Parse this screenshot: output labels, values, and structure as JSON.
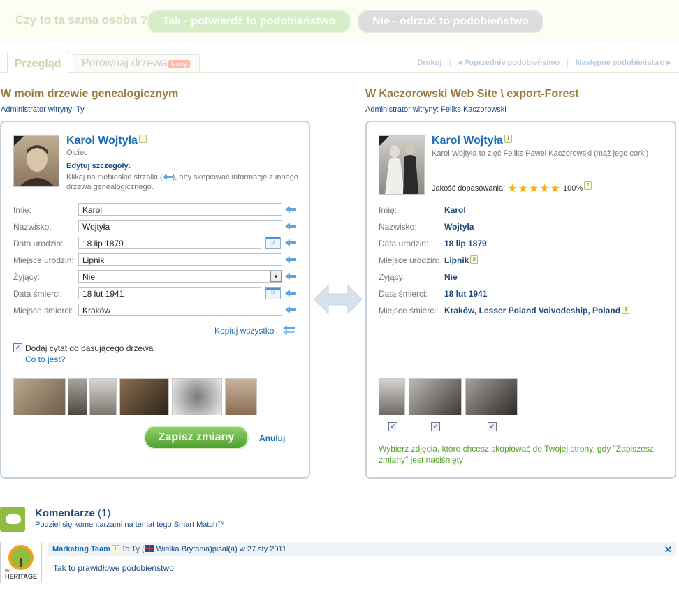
{
  "confirm_bar": {
    "question": "Czy to ta sama osoba ?",
    "confirm_label": "Tak - potwierdź to podobieństwo",
    "reject_label": "Nie - odrzuć to podobieństwo"
  },
  "tabs": {
    "overview": "Przegląd",
    "compare": "Porównaj drzewa",
    "compare_badge": "Nowy"
  },
  "nav": {
    "print": "Drukuj",
    "prev": "Poprzednie podobieństwo",
    "next": "Następne podobieństwo"
  },
  "left": {
    "heading": "W moim drzewie genealogicznym",
    "admin": "Administrator witryny: Ty",
    "person_name": "Karol Wojtyła",
    "relation": "Ojciec",
    "edit_title": "Edytuj szczegóły:",
    "edit_hint_a": "Klikaj na niebieskie strzałki (",
    "edit_hint_b": "), aby skopiować informacje z innego drzewa genealogicznego.",
    "fields": {
      "first_name_label": "Imię:",
      "first_name": "Karol",
      "last_name_label": "Nazwisko:",
      "last_name": "Wojtyła",
      "birth_date_label": "Data urodzin:",
      "birth_date": "18 lip 1879",
      "birth_place_label": "Miejsce urodzin:",
      "birth_place": "Lipnik",
      "living_label": "Żyjący:",
      "living": "Nie",
      "death_date_label": "Data śmierci:",
      "death_date": "18 lut 1941",
      "death_place_label": "Miejsce śmierci:",
      "death_place": "Kraków"
    },
    "copy_all": "Kopiuj wszystko",
    "add_citation": "Dodaj cytat do pasującego drzewa",
    "what_is_it": "Co to jest?",
    "save_label": "Zapisz zmiany",
    "cancel_label": "Anuluj"
  },
  "right": {
    "heading": "W Kaczorowski Web Site \\ export-Forest",
    "admin": "Administrator witryny: Feliks Kaczorowski",
    "person_name": "Karol Wojtyła",
    "relation": "Karol Wojtyła to zięć Feliks Paweł Kaczorowski (mąż jego córki)",
    "match_quality_label": "Jakość dopasowania:",
    "match_stars": 5,
    "match_percent": "100%",
    "fields": {
      "first_name_label": "Imię:",
      "first_name": "Karol",
      "last_name_label": "Nazwisko:",
      "last_name": "Wojtyła",
      "birth_date_label": "Data urodzin:",
      "birth_date": "18 lip 1879",
      "birth_place_label": "Miejsce urodzin:",
      "birth_place": "Lipnik",
      "living_label": "Żyjący:",
      "living": "Nie",
      "death_date_label": "Data śmierci:",
      "death_date": "18 lut 1941",
      "death_place_label": "Miejsce śmierci:",
      "death_place": "Kraków, Lesser Poland Voivodeship, Poland"
    },
    "photo_hint": "Wybierz zdjęcia, które chcesz skopiować do Twojej strony, gdy \"Zapiszesz zmiany\" jest naciśnięty"
  },
  "comments": {
    "title": "Komentarze",
    "count": "(1)",
    "subtitle": "Podziel się komentarzami na temat tego Smart Match™",
    "author": "Marketing Team",
    "to_text": "To Ty (",
    "country": "Wielka Brytania",
    "wrote_text": ")pisał(a) w 27 sty 2011",
    "body": "Tak to prawidłowe podobieństwo!",
    "logo_small": "my",
    "logo_text": "HERITAGE",
    "close": "✕"
  },
  "colors": {
    "accent_blue": "#1a6cb7",
    "heading_brown": "#9a7a3e",
    "save_green": "#4ea12e"
  }
}
